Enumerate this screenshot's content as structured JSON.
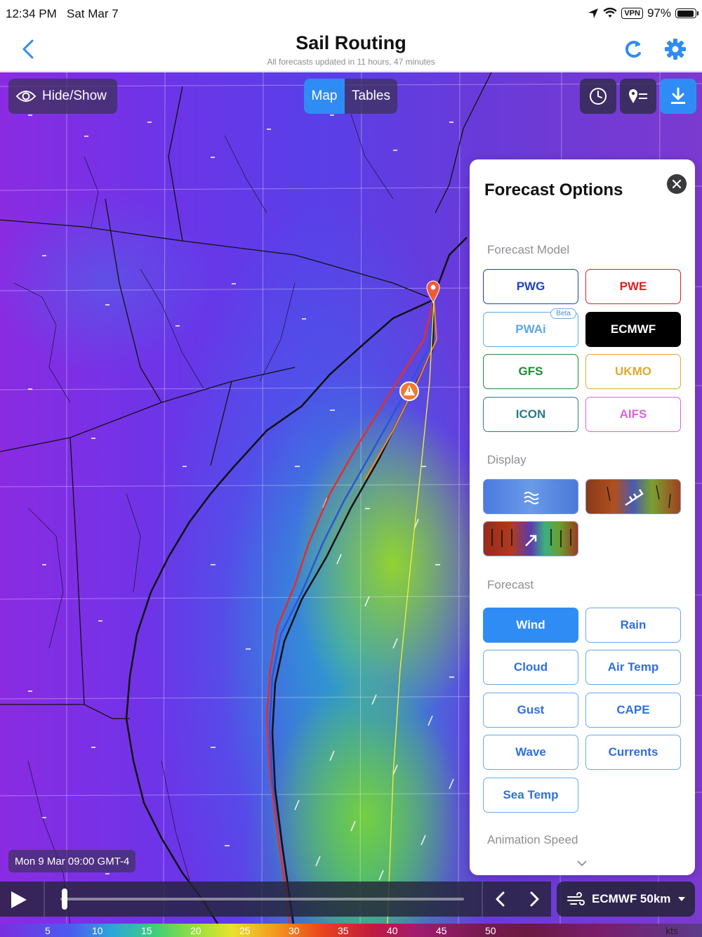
{
  "status": {
    "time": "12:34 PM",
    "date": "Sat Mar 7",
    "vpn": "VPN",
    "battery": "97%",
    "icons": [
      "location-arrow-icon",
      "wifi-icon",
      "battery-icon"
    ]
  },
  "navbar": {
    "title": "Sail Routing",
    "subtitle": "All forecasts updated in 11 hours, 47 minutes",
    "icons": [
      "chevron-left-icon",
      "refresh-icon",
      "gear-icon"
    ],
    "accent": "#2f8cf5"
  },
  "map": {
    "hide_show": "Hide/Show",
    "tabs": [
      {
        "label": "Map",
        "active": true
      },
      {
        "label": "Tables",
        "active": false
      }
    ],
    "tools": [
      "history-clock-icon",
      "waypoints-list-icon",
      "download-icon"
    ],
    "route_colors": {
      "red": "#e0302a",
      "blue": "#2a55d8",
      "black": "#111111",
      "orange": "#f0902a",
      "yellow": "#f5f03a"
    }
  },
  "panel": {
    "title": "Forecast Options",
    "model_label": "Forecast Model",
    "models": [
      {
        "label": "PWG",
        "color": "#1f3fc0",
        "selected": false
      },
      {
        "label": "PWE",
        "color": "#e02020",
        "selected": false
      },
      {
        "label": "PWAi",
        "color": "#5aa8e8",
        "selected": false,
        "badge": "Beta"
      },
      {
        "label": "ECMWF",
        "color": "#000000",
        "selected": true
      },
      {
        "label": "GFS",
        "color": "#1f8a30",
        "selected": false
      },
      {
        "label": "UKMO",
        "color": "#e0a830",
        "selected": false
      },
      {
        "label": "ICON",
        "color": "#2a7a8a",
        "selected": false
      },
      {
        "label": "AIFS",
        "color": "#e060e0",
        "selected": false
      }
    ],
    "display_label": "Display",
    "display_options": [
      "wind-particles-icon",
      "wind-barbs-icon",
      "wind-arrows-icon"
    ],
    "forecast_label": "Forecast",
    "forecasts": [
      {
        "label": "Wind",
        "selected": true
      },
      {
        "label": "Rain",
        "selected": false
      },
      {
        "label": "Cloud",
        "selected": false
      },
      {
        "label": "Air Temp",
        "selected": false
      },
      {
        "label": "Gust",
        "selected": false
      },
      {
        "label": "CAPE",
        "selected": false
      },
      {
        "label": "Wave",
        "selected": false
      },
      {
        "label": "Currents",
        "selected": false
      },
      {
        "label": "Sea Temp",
        "selected": false
      }
    ],
    "animation_label": "Animation Speed"
  },
  "playback": {
    "timestamp": "Mon 9 Mar 09:00 GMT-4",
    "model": "ECMWF 50km",
    "progress": 0.01
  },
  "legend": {
    "unit": "kts",
    "ticks": [
      "5",
      "10",
      "15",
      "20",
      "25",
      "30",
      "35",
      "40",
      "45",
      "50"
    ]
  }
}
